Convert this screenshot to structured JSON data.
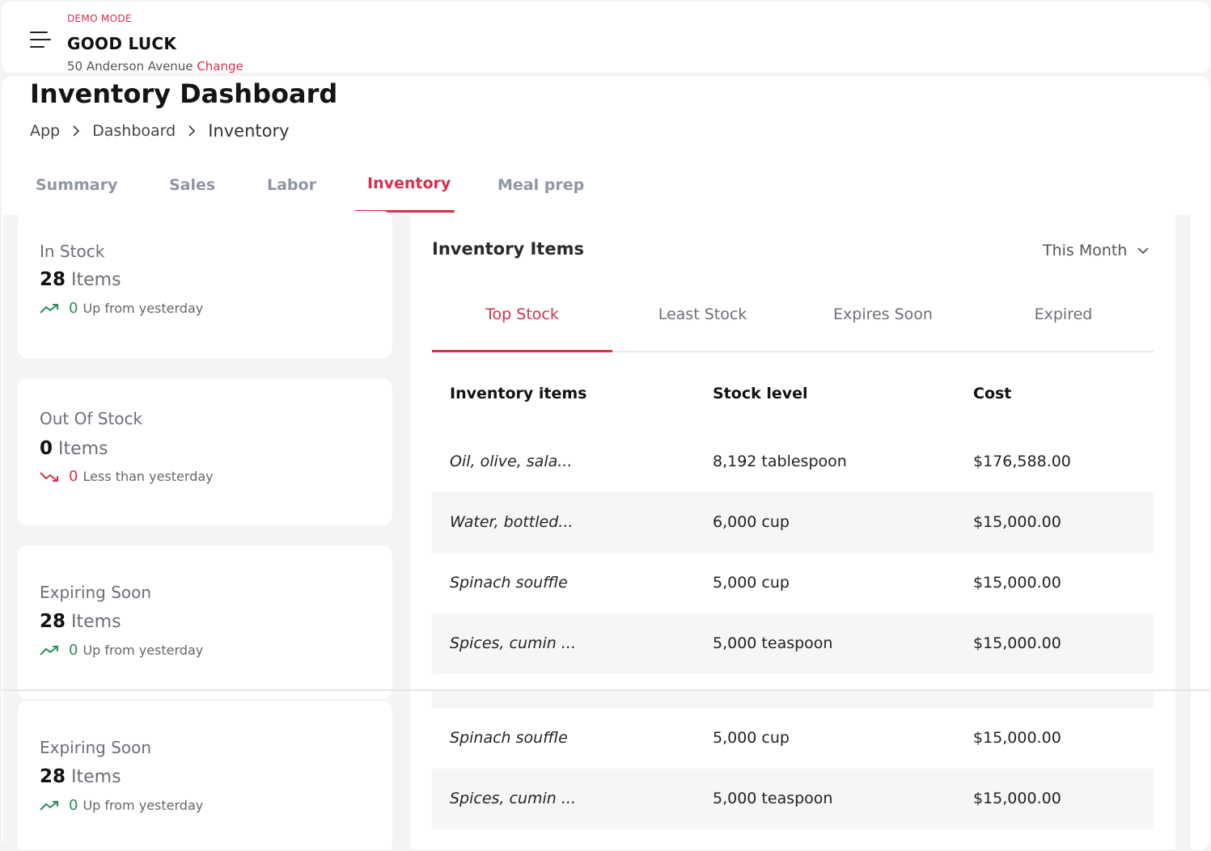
{
  "topbar": {
    "demo_label": "DEMO MODE",
    "brand": "GOOD LUCK",
    "address": "50 Anderson Avenue",
    "change_label": "Change"
  },
  "page": {
    "title": "Inventory Dashboard",
    "breadcrumb": [
      "App",
      "Dashboard",
      "Inventory"
    ]
  },
  "tabs": [
    "Summary",
    "Sales",
    "Labor",
    "Inventory",
    "Meal prep"
  ],
  "active_tab": "Inventory",
  "cards": [
    {
      "title": "In Stock",
      "count": "28",
      "unit": "Items",
      "delta": "0",
      "trend": "Up from yesterday",
      "direction": "up"
    },
    {
      "title": "Out Of Stock",
      "count": "0",
      "unit": "Items",
      "delta": "0",
      "trend": "Less than yesterday",
      "direction": "down"
    },
    {
      "title": "Expiring Soon",
      "count": "28",
      "unit": "Items",
      "delta": "0",
      "trend": "Up from yesterday",
      "direction": "up"
    },
    {
      "title": "Expiring Soon",
      "count": "28",
      "unit": "Items",
      "delta": "0",
      "trend": "Up from yesterday",
      "direction": "up"
    }
  ],
  "panel": {
    "title": "Inventory Items",
    "period": "This Month",
    "subtabs": [
      "Top Stock",
      "Least Stock",
      "Expires Soon",
      "Expired"
    ],
    "active_subtab": "Top Stock",
    "columns": [
      "Inventory items",
      "Stock level",
      "Cost"
    ],
    "rows": [
      {
        "name": "Oil, olive, sala...",
        "stock": "8,192 tablespoon",
        "cost": "$176,588.00"
      },
      {
        "name": "Water, bottled...",
        "stock": "6,000 cup",
        "cost": "$15,000.00"
      },
      {
        "name": "Spinach souffle",
        "stock": "5,000 cup",
        "cost": "$15,000.00"
      },
      {
        "name": "Spices, cumin ...",
        "stock": "5,000 teaspoon",
        "cost": "$15,000.00"
      },
      {
        "name": "Spinach souffle",
        "stock": "5,000 cup",
        "cost": "$15,000.00"
      },
      {
        "name": "Spices, cumin ...",
        "stock": "5,000 teaspoon",
        "cost": "$15,000.00"
      }
    ]
  },
  "colors": {
    "accent": "#d3304b",
    "up": "#2d8a5a",
    "down": "#d3304b"
  },
  "icons": [
    "menu-icon",
    "chevron-right-icon",
    "chevron-down-icon",
    "trend-up-icon",
    "trend-down-icon"
  ]
}
